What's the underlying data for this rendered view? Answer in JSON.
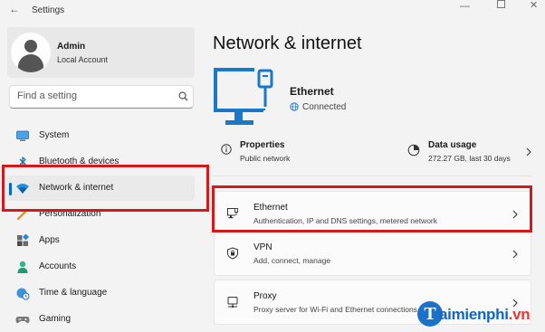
{
  "window": {
    "title": "Settings",
    "controls": {
      "minimize": "—",
      "close": "✕"
    }
  },
  "user": {
    "name": "Admin",
    "account_type": "Local Account"
  },
  "search": {
    "placeholder": "Find a setting"
  },
  "sidebar": {
    "items": [
      {
        "label": "System",
        "icon": "monitor-icon"
      },
      {
        "label": "Bluetooth & devices",
        "icon": "bluetooth-icon"
      },
      {
        "label": "Network & internet",
        "icon": "wifi-icon",
        "active": true
      },
      {
        "label": "Personalization",
        "icon": "brush-icon"
      },
      {
        "label": "Apps",
        "icon": "apps-icon"
      },
      {
        "label": "Accounts",
        "icon": "person-icon"
      },
      {
        "label": "Time & language",
        "icon": "globe-clock-icon"
      },
      {
        "label": "Gaming",
        "icon": "gamepad-icon"
      }
    ]
  },
  "main": {
    "title": "Network & internet",
    "hero": {
      "name": "Ethernet",
      "status": "Connected"
    },
    "properties": {
      "title": "Properties",
      "subtitle": "Public network"
    },
    "data_usage": {
      "title": "Data usage",
      "subtitle": "272.27 GB, last 30 days"
    },
    "cards": [
      {
        "title": "Ethernet",
        "subtitle": "Authentication, IP and DNS settings, metered network",
        "icon": "ethernet-icon"
      },
      {
        "title": "VPN",
        "subtitle": "Add, connect, manage",
        "icon": "shield-icon"
      },
      {
        "title": "Proxy",
        "subtitle": "Proxy server for Wi-Fi and Ethernet connections",
        "icon": "proxy-icon"
      }
    ]
  },
  "watermark": {
    "initial": "T",
    "text_main": "aimienphi",
    "text_tld": ".vn"
  },
  "colors": {
    "accent": "#0067c0",
    "highlight": "#d2191c",
    "ethernet_blue": "#1a78c8"
  }
}
